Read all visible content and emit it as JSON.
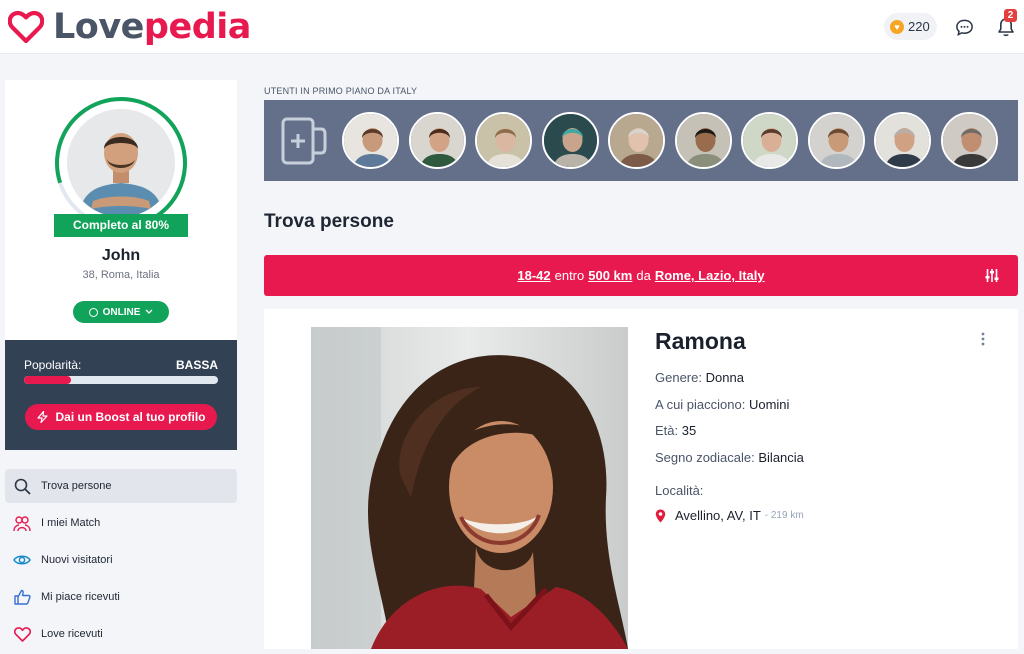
{
  "brand": {
    "part1": "Love",
    "part2": "pedia",
    "color": "#e8194f"
  },
  "header": {
    "credits": "220",
    "notifications_count": "2"
  },
  "profile": {
    "completion_label": "Completo al 80%",
    "completion_percent": 80,
    "name": "John",
    "meta": "38, Roma, Italia",
    "status": "ONLINE"
  },
  "popularity": {
    "label": "Popolarità:",
    "value": "BASSA",
    "fill_percent": 24,
    "boost_label": "Dai un Boost al tuo profilo"
  },
  "nav": [
    {
      "label": "Trova persone",
      "icon": "search-icon"
    },
    {
      "label": "I miei Match",
      "icon": "users-icon"
    },
    {
      "label": "Nuovi visitatori",
      "icon": "eye-icon"
    },
    {
      "label": "Mi piace ricevuti",
      "icon": "thumbs-up-icon"
    },
    {
      "label": "Love ricevuti",
      "icon": "heart-icon"
    }
  ],
  "featured": {
    "label": "UTENTI IN PRIMO PIANO DA ITALY",
    "count": 10
  },
  "search": {
    "title": "Trova persone",
    "age_range": "18-42",
    "within": "entro",
    "distance": "500 km",
    "from": "da",
    "location": "Rome, Lazio, Italy"
  },
  "person": {
    "name": "Ramona",
    "gender_label": "Genere:",
    "gender": "Donna",
    "likes_label": "A cui piacciono:",
    "likes": "Uomini",
    "age_label": "Età:",
    "age": "35",
    "zodiac_label": "Segno zodiacale:",
    "zodiac": "Bilancia",
    "location_label": "Località:",
    "location": "Avellino, AV, IT",
    "distance": "- 219 km"
  }
}
